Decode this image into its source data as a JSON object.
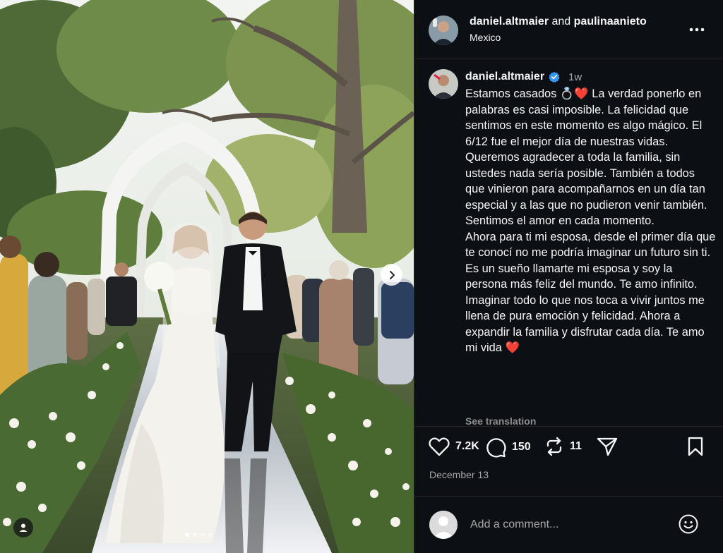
{
  "post": {
    "header": {
      "user1": "daniel.altmaier",
      "and_text": " and ",
      "user2": "paulinaanieto",
      "location": "Mexico",
      "more_icon": "more-horizontal-icon"
    },
    "caption": {
      "username": "daniel.altmaier",
      "verified_icon": "verified-badge-icon",
      "verified_color": "#3797f0",
      "time_ago": "1w",
      "text": "Estamos casados 💍❤️ La verdad ponerlo en palabras es casi imposible. La felicidad que sentimos en este momento es algo mágico. El 6/12 fue el mejor día de nuestras vidas. Queremos agradecer a toda la familia, sin ustedes nada sería posible. También a todos que vinieron para acompañarnos en un día tan especial y a las que no pudieron venir también. Sentimos el amor en cada momento.\nAhora para ti mi esposa, desde el primer día que te conocí no me podría imaginar un futuro sin ti. Es un sueño llamarte mi esposa y soy la persona más feliz del mundo. Te amo infinito. Imaginar todo lo que nos toca a vivir juntos me llena de pura emoción y felicidad. Ahora a expandir la familia y disfrutar cada día. Te amo mi vida ❤️",
      "see_translation": "See translation"
    },
    "actions": {
      "likes": "7.2K",
      "comments": "150",
      "reposts": "11",
      "like_icon": "heart-icon",
      "comment_icon": "comment-bubble-icon",
      "repost_icon": "repost-icon",
      "share_icon": "send-icon",
      "save_icon": "bookmark-icon"
    },
    "date": "December 13",
    "comment_box": {
      "placeholder": "Add a comment...",
      "emoji_icon": "emoji-smile-icon"
    },
    "media": {
      "carousel_count": 4,
      "active_index": 0,
      "next_icon": "chevron-right-icon",
      "tag_icon": "user-tag-icon"
    }
  },
  "theme": {
    "panel_bg": "#0c0f14",
    "text": "#f5f5f5",
    "muted": "#a8a8a8",
    "border": "#262626"
  }
}
